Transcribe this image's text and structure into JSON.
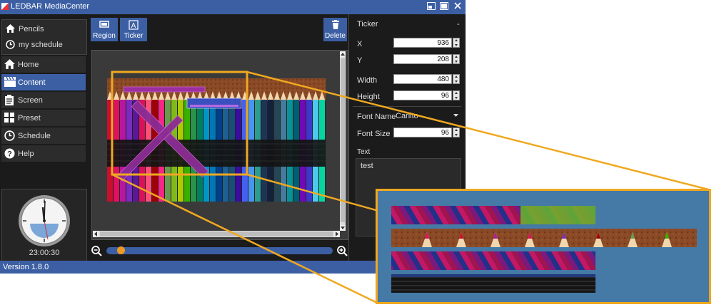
{
  "window": {
    "title": "LEDBAR MediaCenter"
  },
  "sidebar": {
    "top_items": [
      {
        "label": "Pencils",
        "icon": "home-icon"
      },
      {
        "label": "my schedule",
        "icon": "clock-icon"
      }
    ],
    "nav": [
      {
        "label": "Home",
        "icon": "home-icon"
      },
      {
        "label": "Content",
        "icon": "clapper-icon",
        "active": true
      },
      {
        "label": "Screen",
        "icon": "clipboard-icon"
      },
      {
        "label": "Preset",
        "icon": "grid-icon"
      },
      {
        "label": "Schedule",
        "icon": "clock-icon"
      },
      {
        "label": "Help",
        "icon": "help-icon"
      }
    ],
    "clock_time": "23:00:30"
  },
  "toolbar": {
    "region_label": "Region",
    "ticker_label": "Ticker",
    "delete_label": "Delete"
  },
  "properties": {
    "section_title": "Ticker",
    "collapse": "-",
    "x_label": "X",
    "x_value": "936",
    "y_label": "Y",
    "y_value": "208",
    "width_label": "Width",
    "width_value": "480",
    "height_label": "Height",
    "height_value": "96",
    "font_name_label": "Font Name",
    "font_name_value": "Carlito",
    "font_size_label": "Font Size",
    "font_size_value": "96",
    "text_label": "Text",
    "text_value": "test"
  },
  "status": {
    "version": "Version 1.8.0"
  },
  "zoom": {
    "level": 0.05
  },
  "colors": {
    "accent": "#3c5fa4",
    "highlight": "#f0a820",
    "knob": "#f09b20"
  }
}
